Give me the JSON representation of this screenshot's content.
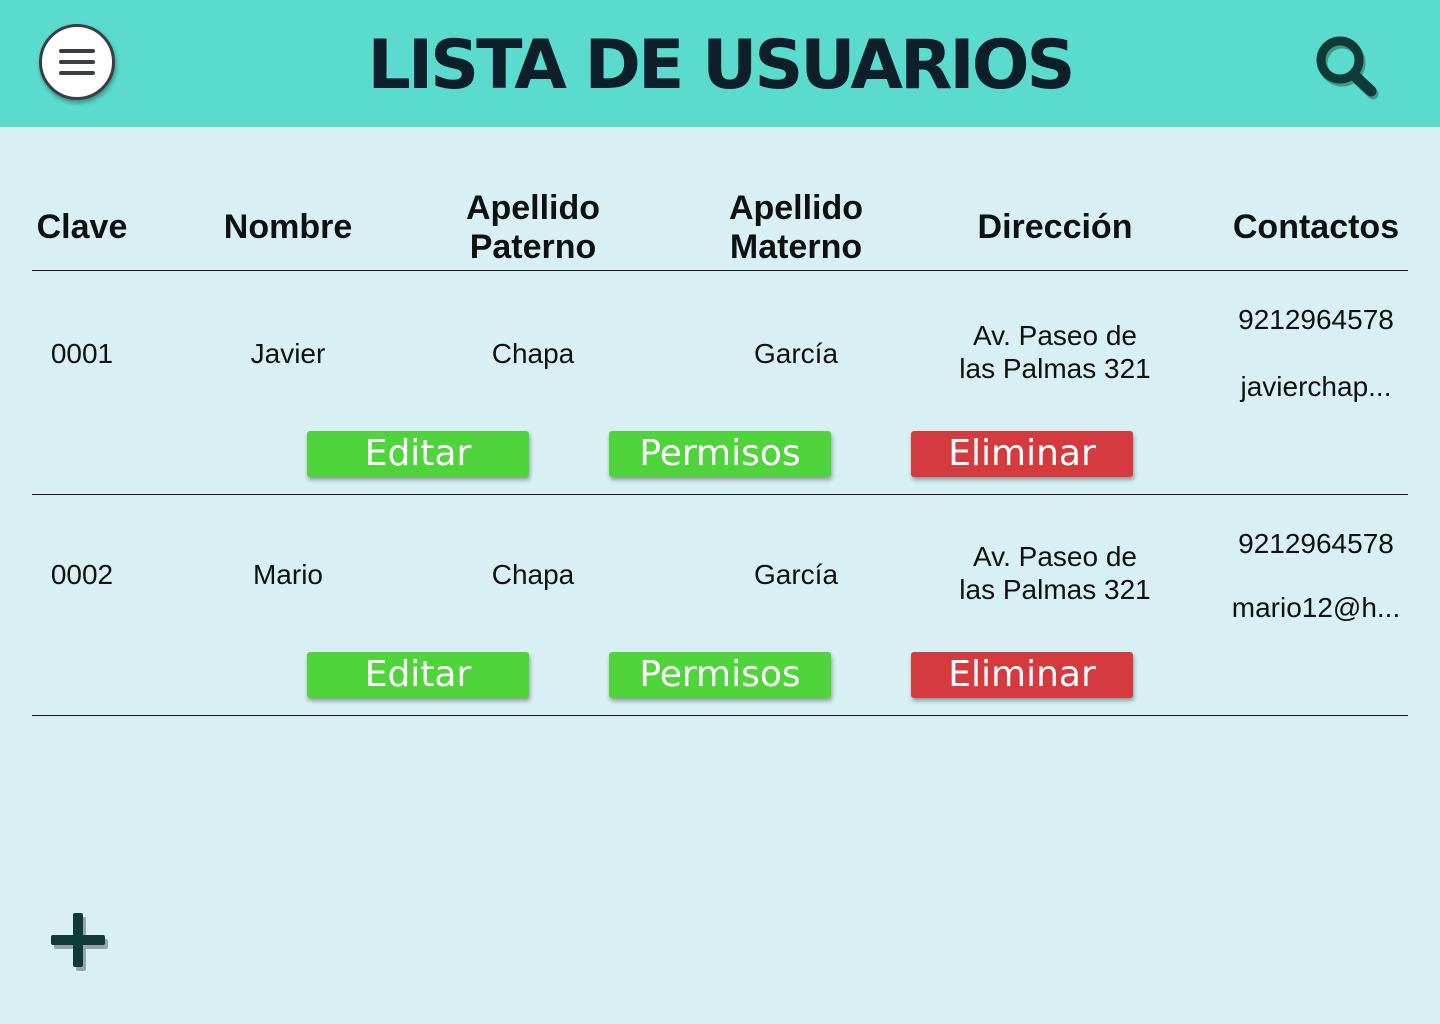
{
  "header": {
    "title": "LISTA DE USUARIOS",
    "menu_icon": "hamburger-menu-icon",
    "search_icon": "search-icon"
  },
  "colors": {
    "header_bg": "#5bdbcd",
    "page_bg": "#d8f0f3",
    "edit_button": "#4fd43b",
    "permissions_button": "#4fd43b",
    "delete_button": "#d53a3e",
    "icon_dark": "#0f3a38"
  },
  "table": {
    "columns": {
      "clave": "Clave",
      "nombre": "Nombre",
      "paterno_1": "Apellido",
      "paterno_2": "Paterno",
      "materno_1": "Apellido",
      "materno_2": "Materno",
      "direccion": "Dirección",
      "contactos": "Contactos"
    },
    "rows": [
      {
        "clave": "0001",
        "nombre": "Javier",
        "apellido_paterno": "Chapa",
        "apellido_materno": "García",
        "direccion_1": "Av. Paseo de",
        "direccion_2": "las Palmas 321",
        "telefono": "9212964578",
        "email": "javierchap...",
        "edit_label": "Editar",
        "permissions_label": "Permisos",
        "delete_label": "Eliminar"
      },
      {
        "clave": "0002",
        "nombre": "Mario",
        "apellido_paterno": "Chapa",
        "apellido_materno": "García",
        "direccion_1": "Av. Paseo de",
        "direccion_2": "las Palmas 321",
        "telefono": "9212964578",
        "email": "mario12@h...",
        "edit_label": "Editar",
        "permissions_label": "Permisos",
        "delete_label": "Eliminar"
      }
    ]
  },
  "footer": {
    "add_icon": "plus-icon"
  }
}
